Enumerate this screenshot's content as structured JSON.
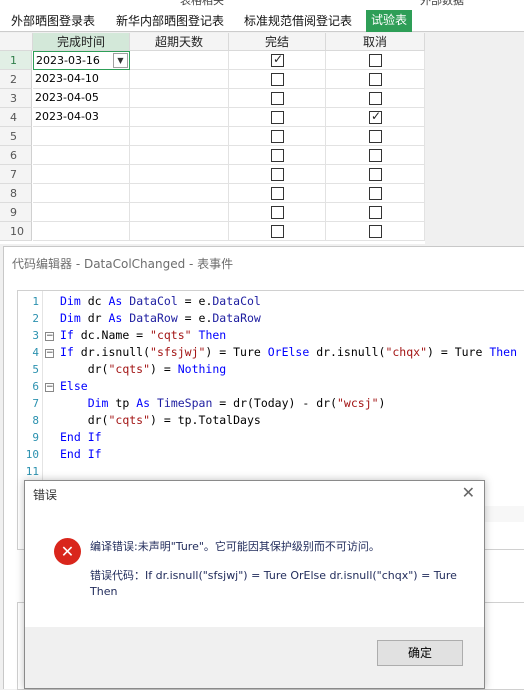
{
  "top_strip": {
    "left_text": "表格相关",
    "right_text": "外部数据"
  },
  "tabs": [
    {
      "label": "外部晒图登录表",
      "active": false
    },
    {
      "label": "新华内部晒图登记表",
      "active": false
    },
    {
      "label": "标准规范借阅登记表",
      "active": false
    },
    {
      "label": "试验表",
      "active": true
    }
  ],
  "grid": {
    "columns": [
      "完成时间",
      "超期天数",
      "完结",
      "取消"
    ],
    "rows": [
      {
        "num": "1",
        "date": "2023-03-16",
        "overdue": "",
        "done": true,
        "cancel": false
      },
      {
        "num": "2",
        "date": "2023-04-10",
        "overdue": "",
        "done": false,
        "cancel": false
      },
      {
        "num": "3",
        "date": "2023-04-05",
        "overdue": "",
        "done": false,
        "cancel": false
      },
      {
        "num": "4",
        "date": "2023-04-03",
        "overdue": "",
        "done": false,
        "cancel": true
      },
      {
        "num": "5",
        "date": "",
        "overdue": "",
        "done": false,
        "cancel": false
      },
      {
        "num": "6",
        "date": "",
        "overdue": "",
        "done": false,
        "cancel": false
      },
      {
        "num": "7",
        "date": "",
        "overdue": "",
        "done": false,
        "cancel": false
      },
      {
        "num": "8",
        "date": "",
        "overdue": "",
        "done": false,
        "cancel": false
      },
      {
        "num": "9",
        "date": "",
        "overdue": "",
        "done": false,
        "cancel": false
      },
      {
        "num": "10",
        "date": "",
        "overdue": "",
        "done": false,
        "cancel": false
      }
    ]
  },
  "editor": {
    "title": "代码编辑器 - DataColChanged - 表事件",
    "line_numbers": [
      "1",
      "2",
      "3",
      "4",
      "5",
      "6",
      "7",
      "8",
      "9",
      "10",
      "11"
    ],
    "code_lines": [
      "Dim dc As DataCol = e.DataCol",
      "Dim dr As DataRow = e.DataRow",
      "If dc.Name = \"cqts\" Then",
      "If dr.isnull(\"sfsjwj\") = Ture OrElse dr.isnull(\"chqx\") = Ture Then",
      "    dr(\"cqts\") = Nothing",
      "Else",
      "    Dim tp As TimeSpan = dr(Today) - dr(\"wcsj\")",
      "    dr(\"cqts\") = tp.TotalDays",
      "End If",
      "End If",
      ""
    ]
  },
  "dialog": {
    "title": "错误",
    "close_glyph": "✕",
    "icon_glyph": "✕",
    "message": "编译错误:未声明\"Ture\"。它可能因其保护级别而不可访问。",
    "detail": "错误代码：If dr.isnull(\"sfsjwj\") = Ture OrElse dr.isnull(\"chqx\") = Ture Then",
    "ok_label": "确定"
  },
  "colors": {
    "accent": "#2e9e57",
    "error": "#d9261c",
    "keyword": "#0000ff",
    "string": "#a31515",
    "line_number": "#2b91af"
  }
}
